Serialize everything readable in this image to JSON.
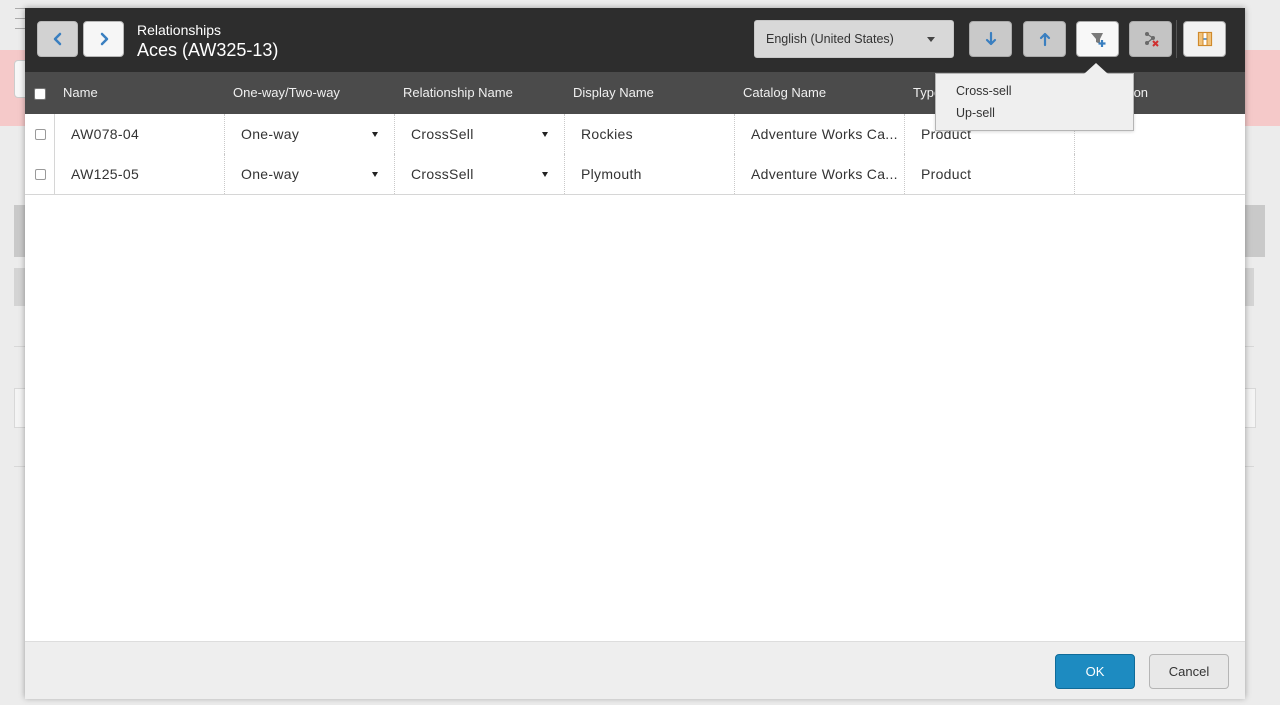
{
  "header": {
    "subtitle": "Relationships",
    "title": "Aces (AW325-13)"
  },
  "language": {
    "selected": "English (United States)"
  },
  "grid": {
    "columns": [
      "Name",
      "One-way/Two-way",
      "Relationship Name",
      "Display Name",
      "Catalog Name",
      "Type",
      "Description"
    ],
    "rows": [
      [
        "AW078-04",
        "One-way",
        "CrossSell",
        "Rockies",
        "Adventure Works Ca...",
        "Product",
        ""
      ],
      [
        "AW125-05",
        "One-way",
        "CrossSell",
        "Plymouth",
        "Adventure Works Ca...",
        "Product",
        ""
      ]
    ]
  },
  "popover": {
    "items": [
      "Cross-sell",
      "Up-sell"
    ]
  },
  "footer": {
    "ok_label": "OK",
    "cancel_label": "Cancel"
  },
  "colors": {
    "header_bg": "#2d2d2d",
    "grid_header_bg": "#4b4b4b",
    "primary": "#1d8bc1",
    "nav_arrow": "#3a7fc0"
  },
  "icons": {
    "prev": "chevron-left-icon",
    "next": "chevron-right-icon",
    "move_down": "arrow-down-icon",
    "move_up": "arrow-up-icon",
    "add_relationship": "add-relationship-icon",
    "remove_relationship": "remove-relationship-icon",
    "columns": "column-chooser-icon"
  }
}
